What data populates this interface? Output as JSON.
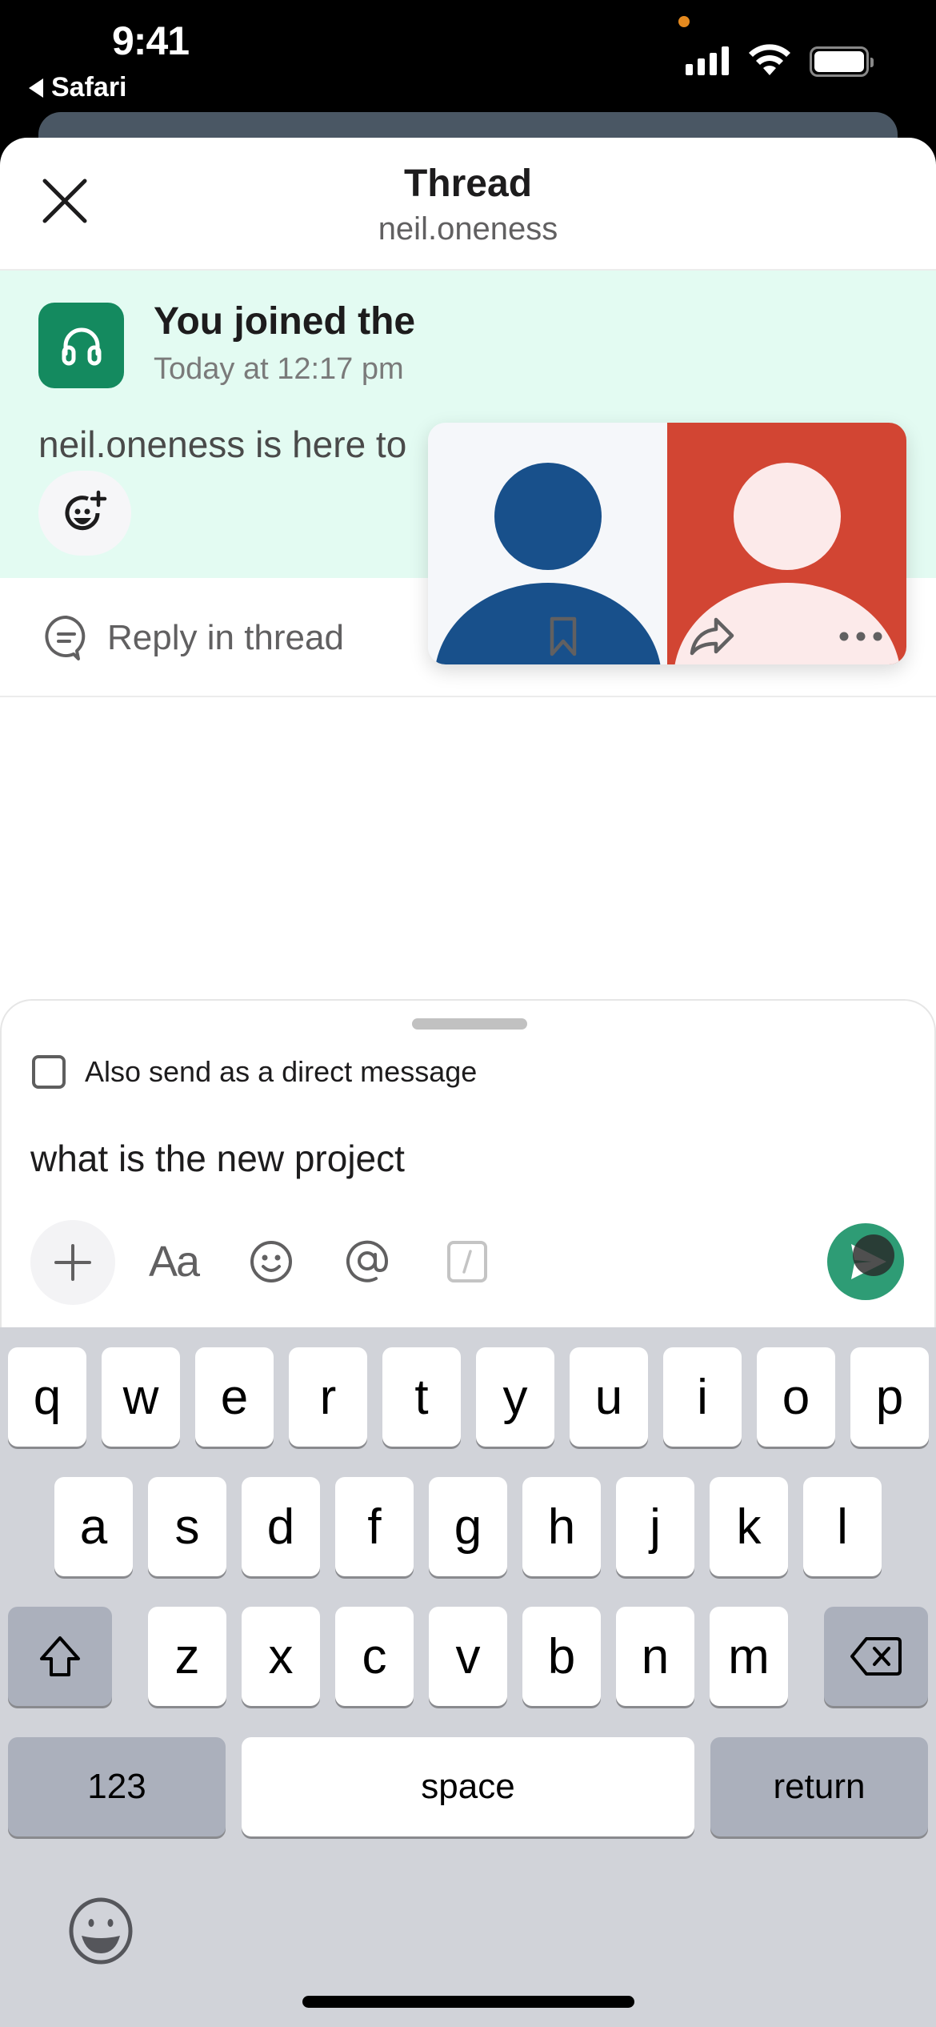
{
  "status_bar": {
    "time": "9:41",
    "back_app": "Safari",
    "signal_bars": 4,
    "battery_level": 1.0
  },
  "header": {
    "title": "Thread",
    "subtitle": "neil.oneness",
    "close_icon": "close-icon"
  },
  "message": {
    "avatar_icon": "headphones-icon",
    "avatar_color": "#148a5f",
    "title": "You joined the",
    "time": "Today at 12:17 pm",
    "body": "neil.oneness is here to",
    "reaction_icon": "add-reaction-icon",
    "background": "#e3fbf2"
  },
  "video_tile": {
    "participants": [
      {
        "name": "participant-1",
        "bg": "#f5f7fa",
        "fg": "#18508b"
      },
      {
        "name": "participant-2",
        "bg": "#d24533",
        "fg": "#fceaea"
      }
    ]
  },
  "actions": {
    "reply_label": "Reply in thread",
    "icons": [
      "bookmark-icon",
      "share-icon",
      "more-icon"
    ]
  },
  "composer": {
    "dm_checkbox_label": "Also send as a direct message",
    "dm_checked": false,
    "input_value": "what is the new project",
    "format_label": "Aa",
    "send_color": "#2e9c75"
  },
  "keyboard": {
    "row1": [
      "q",
      "w",
      "e",
      "r",
      "t",
      "y",
      "u",
      "i",
      "o",
      "p"
    ],
    "row2": [
      "a",
      "s",
      "d",
      "f",
      "g",
      "h",
      "j",
      "k",
      "l"
    ],
    "row3": [
      "z",
      "x",
      "c",
      "v",
      "b",
      "n",
      "m"
    ],
    "numbers_label": "123",
    "space_label": "space",
    "return_label": "return"
  }
}
